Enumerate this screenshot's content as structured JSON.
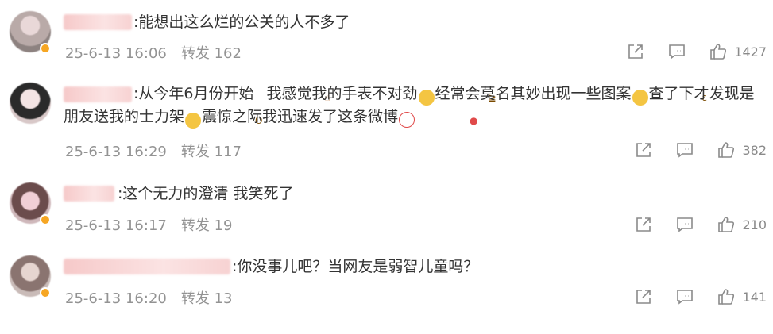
{
  "comments": [
    {
      "text": ":能想出这么烂的公关的人不多了",
      "time": "25-6-13 16:06",
      "repost": "转发 162",
      "likes": "1427"
    },
    {
      "text_parts": [
        ":从今年6月份开始",
        "我感觉我的手表不对劲",
        "经常会莫名其妙出现一些图案",
        "查了下才发现是朋友送我的士力架",
        "震惊之际我迅速发了这条微博"
      ],
      "time": "25-6-13 16:29",
      "repost": "转发 117",
      "likes": "382"
    },
    {
      "text": ":这个无力的澄清 我笑死了",
      "time": "25-6-13 16:17",
      "repost": "转发 19",
      "likes": "210"
    },
    {
      "text": ":你没事儿吧？当网友是弱智儿童吗？",
      "time": "25-6-13 16:20",
      "repost": "转发 13",
      "likes": "141"
    }
  ],
  "icons": {
    "share": "share-icon",
    "comment": "comment-icon",
    "like": "thumbs-up-icon"
  },
  "colors": {
    "text": "#333333",
    "meta": "#939393",
    "badge": "#f6a623"
  }
}
